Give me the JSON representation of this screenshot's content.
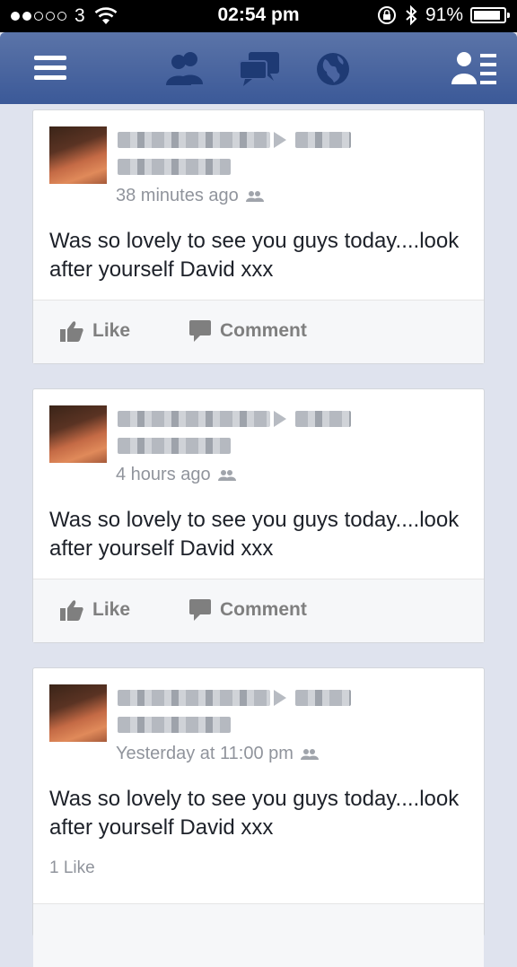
{
  "status_bar": {
    "carrier": "3",
    "time": "02:54 pm",
    "battery": "91%",
    "battery_level": 0.91,
    "signal_bars_filled": 2,
    "signal_bars_total": 5
  },
  "navbar": {
    "icons": [
      "menu-icon",
      "friends-icon",
      "messages-icon",
      "globe-icon",
      "profile-list-icon"
    ],
    "color": "#3b5998"
  },
  "posts": [
    {
      "timestamp": "38 minutes ago",
      "text": "Was so lovely to see you guys today....look after yourself David xxx",
      "like_label": "Like",
      "comment_label": "Comment"
    },
    {
      "timestamp": "4 hours ago",
      "text": "Was so lovely to see you guys today....look after yourself David xxx",
      "like_label": "Like",
      "comment_label": "Comment"
    },
    {
      "timestamp": "Yesterday at 11:00 pm",
      "text": "Was so lovely to see you guys today....look after yourself David xxx",
      "likes_count": "1 Like"
    }
  ]
}
